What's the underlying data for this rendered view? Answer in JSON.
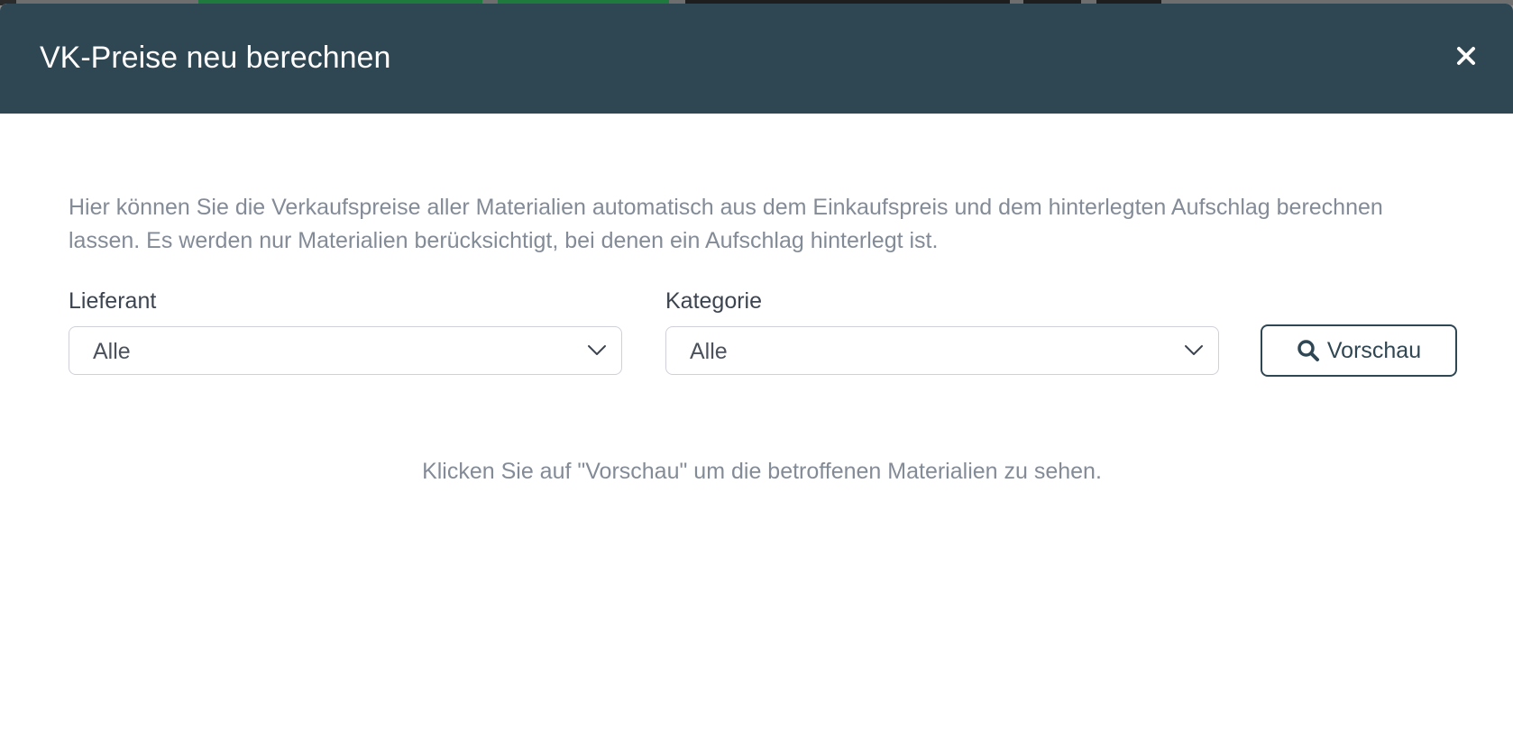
{
  "dialog": {
    "title": "VK-Preise neu berechnen",
    "close_icon": "close-icon",
    "intro_text": "Hier können Sie die Verkaufspreise aller Materialien automatisch aus dem Einkaufspreis und dem hinterlegten Aufschlag berechnen lassen. Es werden nur Materialien berücksichtigt, bei denen ein Aufschlag hinterlegt ist.",
    "filters": {
      "supplier": {
        "label": "Lieferant",
        "selected": "Alle"
      },
      "category": {
        "label": "Kategorie",
        "selected": "Alle"
      }
    },
    "preview_button": {
      "label": "Vorschau",
      "icon": "search-icon"
    },
    "hint_text": "Klicken Sie auf \"Vorschau\" um die betroffenen Materialien zu sehen."
  },
  "colors": {
    "header_bg": "#2f4653",
    "accent": "#2f4653",
    "muted_text": "#838b97",
    "border": "#cfd0da"
  }
}
